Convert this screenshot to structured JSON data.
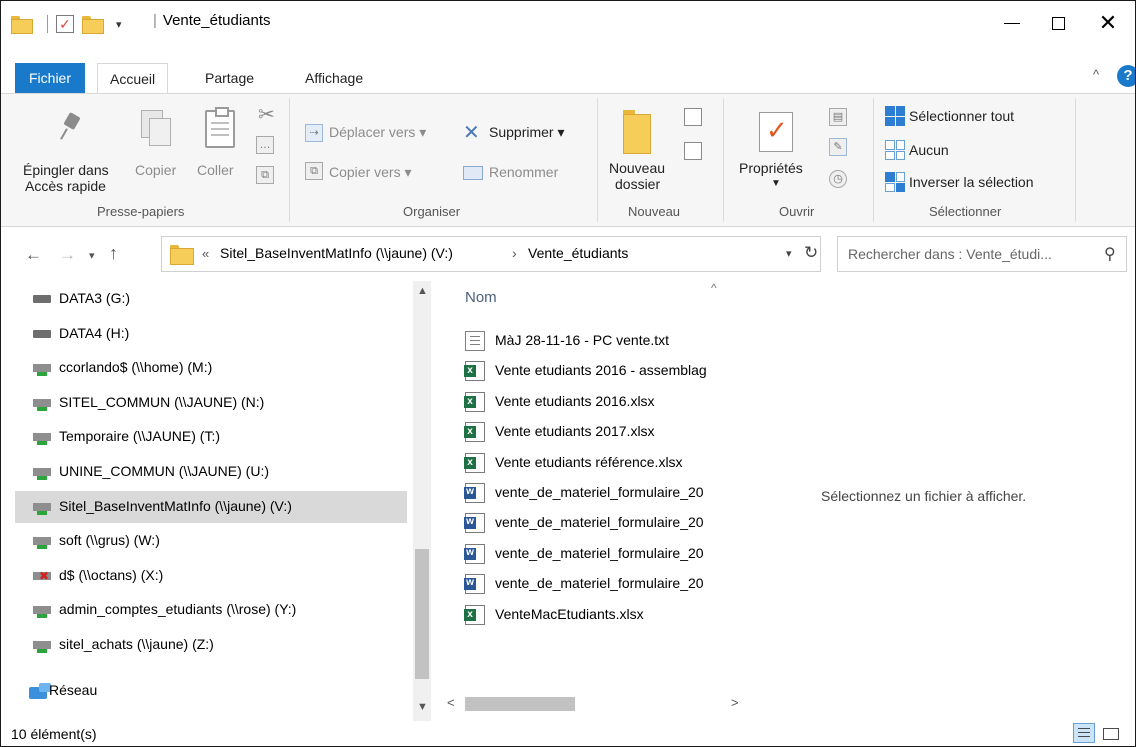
{
  "window": {
    "title": "Vente_étudiants",
    "qat_dropdown": "▾"
  },
  "ribbon_tabs": [
    "Fichier",
    "Accueil",
    "Partage",
    "Affichage"
  ],
  "ribbon": {
    "presse_papiers": {
      "group_label": "Presse-papiers",
      "pin_line1": "Épingler dans",
      "pin_line2": "Accès rapide",
      "copy": "Copier",
      "paste": "Coller"
    },
    "organiser": {
      "group_label": "Organiser",
      "move_to": "Déplacer vers",
      "copy_to": "Copier vers",
      "delete": "Supprimer",
      "rename": "Renommer"
    },
    "nouveau": {
      "group_label": "Nouveau",
      "new_folder_line1": "Nouveau",
      "new_folder_line2": "dossier"
    },
    "ouvrir": {
      "group_label": "Ouvrir",
      "properties": "Propriétés"
    },
    "selectionner": {
      "group_label": "Sélectionner",
      "select_all": "Sélectionner tout",
      "select_none": "Aucun",
      "invert": "Inverser la sélection"
    }
  },
  "address": {
    "overflow": "«",
    "segments": [
      "Sitel_BaseInventMatInfo (\\\\jaune) (V:)",
      "Vente_étudiants"
    ],
    "separator": "›"
  },
  "search": {
    "placeholder": "Rechercher dans : Vente_étudi..."
  },
  "nav_pane": {
    "items": [
      {
        "label": "DATA3 (G:)",
        "icon": "local-drive-icon"
      },
      {
        "label": "DATA4 (H:)",
        "icon": "local-drive-icon"
      },
      {
        "label": "ccorlando$ (\\\\home) (M:)",
        "icon": "network-drive-icon"
      },
      {
        "label": "SITEL_COMMUN (\\\\JAUNE) (N:)",
        "icon": "network-drive-icon"
      },
      {
        "label": "Temporaire (\\\\JAUNE) (T:)",
        "icon": "network-drive-icon"
      },
      {
        "label": "UNINE_COMMUN (\\\\JAUNE) (U:)",
        "icon": "network-drive-icon"
      },
      {
        "label": "Sitel_BaseInventMatInfo (\\\\jaune) (V:)",
        "icon": "network-drive-icon",
        "selected": true
      },
      {
        "label": "soft (\\\\grus) (W:)",
        "icon": "network-drive-icon"
      },
      {
        "label": "d$ (\\\\octans) (X:)",
        "icon": "disconnected-drive-icon"
      },
      {
        "label": "admin_comptes_etudiants (\\\\rose) (Y:)",
        "icon": "network-drive-icon"
      },
      {
        "label": "sitel_achats (\\\\jaune) (Z:)",
        "icon": "network-drive-icon"
      }
    ],
    "network": "Réseau"
  },
  "file_list": {
    "column_header": "Nom",
    "files": [
      {
        "name": "MàJ 28-11-16 - PC vente.txt",
        "type": "txt"
      },
      {
        "name": "Vente etudiants 2016 - assemblag",
        "type": "xlsx"
      },
      {
        "name": "Vente etudiants 2016.xlsx",
        "type": "xlsx"
      },
      {
        "name": "Vente etudiants 2017.xlsx",
        "type": "xlsx"
      },
      {
        "name": "Vente etudiants référence.xlsx",
        "type": "xlsx"
      },
      {
        "name": "vente_de_materiel_formulaire_20",
        "type": "docx"
      },
      {
        "name": "vente_de_materiel_formulaire_20",
        "type": "docx"
      },
      {
        "name": "vente_de_materiel_formulaire_20",
        "type": "docx"
      },
      {
        "name": "vente_de_materiel_formulaire_20",
        "type": "docx"
      },
      {
        "name": "VenteMacEtudiants.xlsx",
        "type": "xlsx"
      }
    ]
  },
  "preview": {
    "message": "Sélectionnez un fichier à afficher."
  },
  "status": {
    "count": "10 élément(s)"
  },
  "colors": {
    "accent": "#1979ca",
    "selection": "#d9d9d9",
    "folder": "#f6cd58"
  }
}
